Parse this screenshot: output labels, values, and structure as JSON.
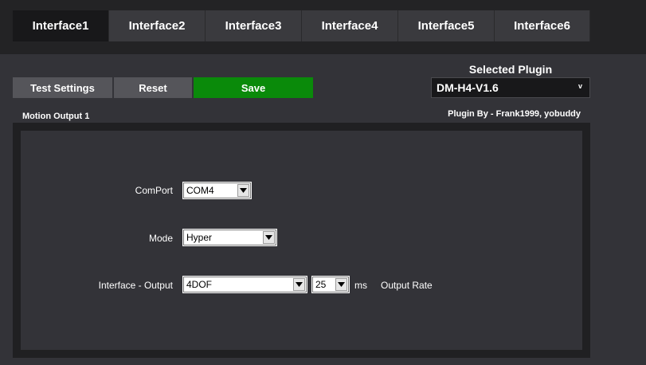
{
  "tabs": [
    {
      "label": "Interface1",
      "active": true
    },
    {
      "label": "Interface2",
      "active": false
    },
    {
      "label": "Interface3",
      "active": false
    },
    {
      "label": "Interface4",
      "active": false
    },
    {
      "label": "Interface5",
      "active": false
    },
    {
      "label": "Interface6",
      "active": false
    }
  ],
  "toolbar": {
    "test_label": "Test Settings",
    "reset_label": "Reset",
    "save_label": "Save"
  },
  "plugin": {
    "title": "Selected Plugin",
    "selected": "DM-H4-V1.6",
    "author": "Plugin By - Frank1999, yobuddy"
  },
  "section": {
    "label": "Motion Output 1"
  },
  "form": {
    "comport_label": "ComPort",
    "comport_value": "COM4",
    "mode_label": "Mode",
    "mode_value": "Hyper",
    "output_label": "Interface - Output",
    "output_value": "4DOF",
    "rate_value": "25",
    "rate_unit": "ms",
    "rate_label": "Output Rate"
  },
  "colors": {
    "save_green": "#0a8a0a",
    "active_tab": "#18181a",
    "background": "#333338"
  }
}
